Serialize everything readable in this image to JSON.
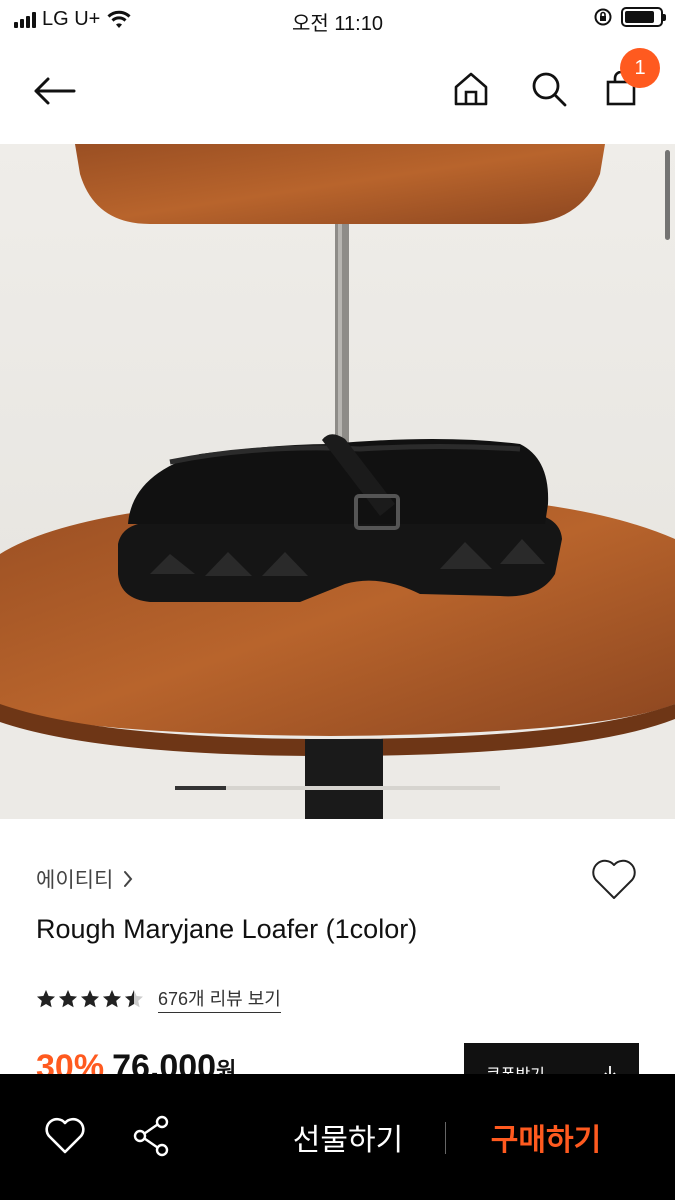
{
  "status_bar": {
    "carrier": "LG U+",
    "time": "오전 11:10",
    "battery_level": 0.85
  },
  "nav": {
    "cart_count": "1"
  },
  "product": {
    "brand": "에이티티",
    "name": "Rough Maryjane Loafer (1color)",
    "rating": 4.5,
    "review_link": "676개 리뷰 보기",
    "discount": "30%",
    "price": "76,000",
    "price_unit": "원",
    "coupon_label": "쿠폰받기",
    "image_index": 1,
    "image_count": 6
  },
  "bottom_bar": {
    "gift_label": "선물하기",
    "buy_label": "구매하기"
  },
  "colors": {
    "accent": "#ff5a1f",
    "dark": "#111111"
  },
  "icons": [
    "back-arrow-icon",
    "home-icon",
    "search-icon",
    "shopping-bag-icon",
    "heart-icon",
    "share-icon",
    "chevron-right-icon",
    "download-icon",
    "star-icon"
  ]
}
